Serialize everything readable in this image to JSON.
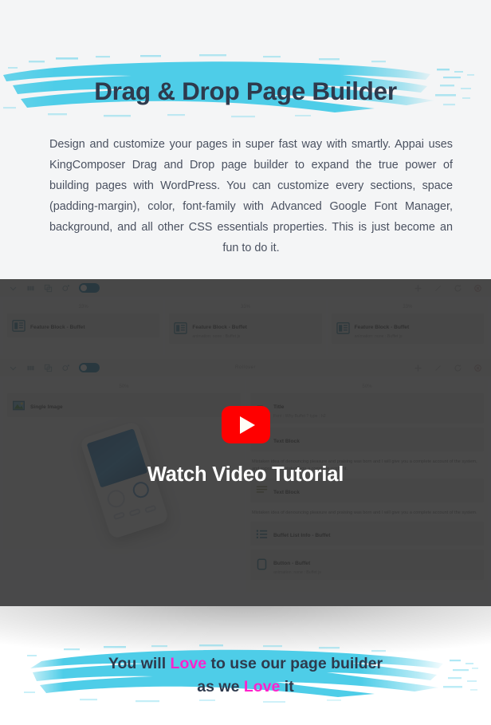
{
  "hero": {
    "title": "Drag & Drop Page Builder",
    "paragraph": "Design and customize your pages in super fast way with smartly. Appai uses KingComposer Drag and Drop page builder to expand the true power of building pages with WordPress. You can customize every sections, space (padding-margin), color, font-family with Advanced Google Font Manager, background, and all other CSS essentials properties. This is just become an fun to do it.",
    "brush_color": "#4ecde8",
    "title_color": "#2e3a4d"
  },
  "video": {
    "caption": "Watch Video Tutorial",
    "play_button_color": "#ff0000",
    "overlay_color": "#2d2d2d"
  },
  "builder": {
    "row1": {
      "column_label": "17%",
      "toolbar_left_icons": [
        "chevron-down-icon",
        "columns-icon",
        "duplicate-icon",
        "settings-icon"
      ],
      "toolbar_right_icons": [
        "plus-icon",
        "edit-icon",
        "clone-icon",
        "delete-icon"
      ],
      "columns": [
        {
          "pct": "33%",
          "widgets": [
            {
              "title": "Feature Block - Buffet",
              "sub": ""
            }
          ]
        },
        {
          "pct": "33%",
          "widgets": [
            {
              "title": "Feature Block - Buffet",
              "sub": "animation: none : Buffet js"
            }
          ]
        },
        {
          "pct": "33%",
          "widgets": [
            {
              "title": "Feature Block - Buffet",
              "sub": "animation: none : Buffet js"
            }
          ]
        }
      ]
    },
    "row2": {
      "row_name": "Rollover",
      "columns": [
        {
          "pct": "50%",
          "widgets": [
            {
              "title": "Single Image",
              "sub": ""
            }
          ],
          "has_phone_image": true
        },
        {
          "pct": "50%",
          "widgets": [
            {
              "title": "Title",
              "sub": "Font : Why Buffet ? type : h2"
            },
            {
              "title": "Text Block",
              "sub": ""
            }
          ],
          "paragraph1": "Mistaken idea of denouncing pleasure and praising was born and I will give you a complete account of the system, and expound, mistaken you a complete account.",
          "widgets2": [
            {
              "title": "Text Block",
              "sub": ""
            }
          ],
          "paragraph2": "Mistaken idea of denouncing pleasure and praising was born and I will give you a complete account of the system.",
          "widgets3": [
            {
              "title": "Buffet List Info - Buffet",
              "sub": ""
            },
            {
              "title": "Button - Buffet",
              "sub": "animation: none : Buffet js"
            }
          ]
        }
      ]
    }
  },
  "bottom": {
    "line1_part1": "You will ",
    "line1_love": "Love",
    "line1_part2": " to use our page builder",
    "line2_part1": "as we ",
    "line2_love": "Love",
    "line2_part2": " it",
    "love_color": "#ff22cc",
    "brush_color": "#4ecde8"
  }
}
